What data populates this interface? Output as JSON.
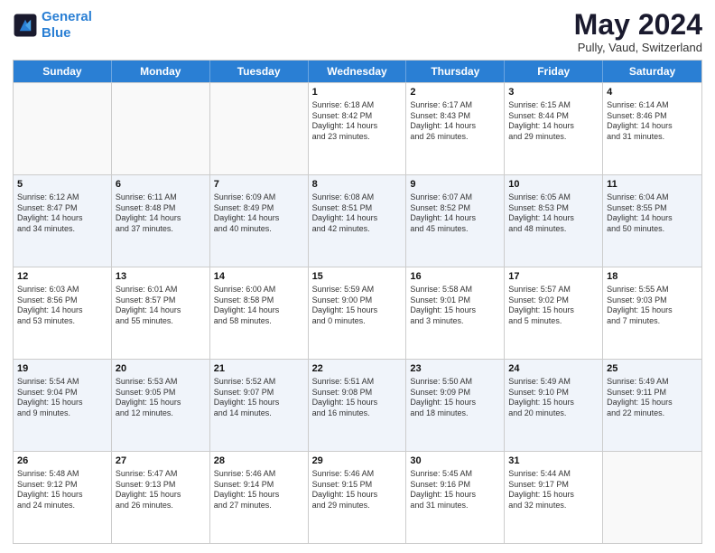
{
  "logo": {
    "line1": "General",
    "line2": "Blue"
  },
  "title": "May 2024",
  "subtitle": "Pully, Vaud, Switzerland",
  "weekdays": [
    "Sunday",
    "Monday",
    "Tuesday",
    "Wednesday",
    "Thursday",
    "Friday",
    "Saturday"
  ],
  "rows": [
    [
      {
        "day": "",
        "info": ""
      },
      {
        "day": "",
        "info": ""
      },
      {
        "day": "",
        "info": ""
      },
      {
        "day": "1",
        "info": "Sunrise: 6:18 AM\nSunset: 8:42 PM\nDaylight: 14 hours\nand 23 minutes."
      },
      {
        "day": "2",
        "info": "Sunrise: 6:17 AM\nSunset: 8:43 PM\nDaylight: 14 hours\nand 26 minutes."
      },
      {
        "day": "3",
        "info": "Sunrise: 6:15 AM\nSunset: 8:44 PM\nDaylight: 14 hours\nand 29 minutes."
      },
      {
        "day": "4",
        "info": "Sunrise: 6:14 AM\nSunset: 8:46 PM\nDaylight: 14 hours\nand 31 minutes."
      }
    ],
    [
      {
        "day": "5",
        "info": "Sunrise: 6:12 AM\nSunset: 8:47 PM\nDaylight: 14 hours\nand 34 minutes."
      },
      {
        "day": "6",
        "info": "Sunrise: 6:11 AM\nSunset: 8:48 PM\nDaylight: 14 hours\nand 37 minutes."
      },
      {
        "day": "7",
        "info": "Sunrise: 6:09 AM\nSunset: 8:49 PM\nDaylight: 14 hours\nand 40 minutes."
      },
      {
        "day": "8",
        "info": "Sunrise: 6:08 AM\nSunset: 8:51 PM\nDaylight: 14 hours\nand 42 minutes."
      },
      {
        "day": "9",
        "info": "Sunrise: 6:07 AM\nSunset: 8:52 PM\nDaylight: 14 hours\nand 45 minutes."
      },
      {
        "day": "10",
        "info": "Sunrise: 6:05 AM\nSunset: 8:53 PM\nDaylight: 14 hours\nand 48 minutes."
      },
      {
        "day": "11",
        "info": "Sunrise: 6:04 AM\nSunset: 8:55 PM\nDaylight: 14 hours\nand 50 minutes."
      }
    ],
    [
      {
        "day": "12",
        "info": "Sunrise: 6:03 AM\nSunset: 8:56 PM\nDaylight: 14 hours\nand 53 minutes."
      },
      {
        "day": "13",
        "info": "Sunrise: 6:01 AM\nSunset: 8:57 PM\nDaylight: 14 hours\nand 55 minutes."
      },
      {
        "day": "14",
        "info": "Sunrise: 6:00 AM\nSunset: 8:58 PM\nDaylight: 14 hours\nand 58 minutes."
      },
      {
        "day": "15",
        "info": "Sunrise: 5:59 AM\nSunset: 9:00 PM\nDaylight: 15 hours\nand 0 minutes."
      },
      {
        "day": "16",
        "info": "Sunrise: 5:58 AM\nSunset: 9:01 PM\nDaylight: 15 hours\nand 3 minutes."
      },
      {
        "day": "17",
        "info": "Sunrise: 5:57 AM\nSunset: 9:02 PM\nDaylight: 15 hours\nand 5 minutes."
      },
      {
        "day": "18",
        "info": "Sunrise: 5:55 AM\nSunset: 9:03 PM\nDaylight: 15 hours\nand 7 minutes."
      }
    ],
    [
      {
        "day": "19",
        "info": "Sunrise: 5:54 AM\nSunset: 9:04 PM\nDaylight: 15 hours\nand 9 minutes."
      },
      {
        "day": "20",
        "info": "Sunrise: 5:53 AM\nSunset: 9:05 PM\nDaylight: 15 hours\nand 12 minutes."
      },
      {
        "day": "21",
        "info": "Sunrise: 5:52 AM\nSunset: 9:07 PM\nDaylight: 15 hours\nand 14 minutes."
      },
      {
        "day": "22",
        "info": "Sunrise: 5:51 AM\nSunset: 9:08 PM\nDaylight: 15 hours\nand 16 minutes."
      },
      {
        "day": "23",
        "info": "Sunrise: 5:50 AM\nSunset: 9:09 PM\nDaylight: 15 hours\nand 18 minutes."
      },
      {
        "day": "24",
        "info": "Sunrise: 5:49 AM\nSunset: 9:10 PM\nDaylight: 15 hours\nand 20 minutes."
      },
      {
        "day": "25",
        "info": "Sunrise: 5:49 AM\nSunset: 9:11 PM\nDaylight: 15 hours\nand 22 minutes."
      }
    ],
    [
      {
        "day": "26",
        "info": "Sunrise: 5:48 AM\nSunset: 9:12 PM\nDaylight: 15 hours\nand 24 minutes."
      },
      {
        "day": "27",
        "info": "Sunrise: 5:47 AM\nSunset: 9:13 PM\nDaylight: 15 hours\nand 26 minutes."
      },
      {
        "day": "28",
        "info": "Sunrise: 5:46 AM\nSunset: 9:14 PM\nDaylight: 15 hours\nand 27 minutes."
      },
      {
        "day": "29",
        "info": "Sunrise: 5:46 AM\nSunset: 9:15 PM\nDaylight: 15 hours\nand 29 minutes."
      },
      {
        "day": "30",
        "info": "Sunrise: 5:45 AM\nSunset: 9:16 PM\nDaylight: 15 hours\nand 31 minutes."
      },
      {
        "day": "31",
        "info": "Sunrise: 5:44 AM\nSunset: 9:17 PM\nDaylight: 15 hours\nand 32 minutes."
      },
      {
        "day": "",
        "info": ""
      }
    ]
  ]
}
